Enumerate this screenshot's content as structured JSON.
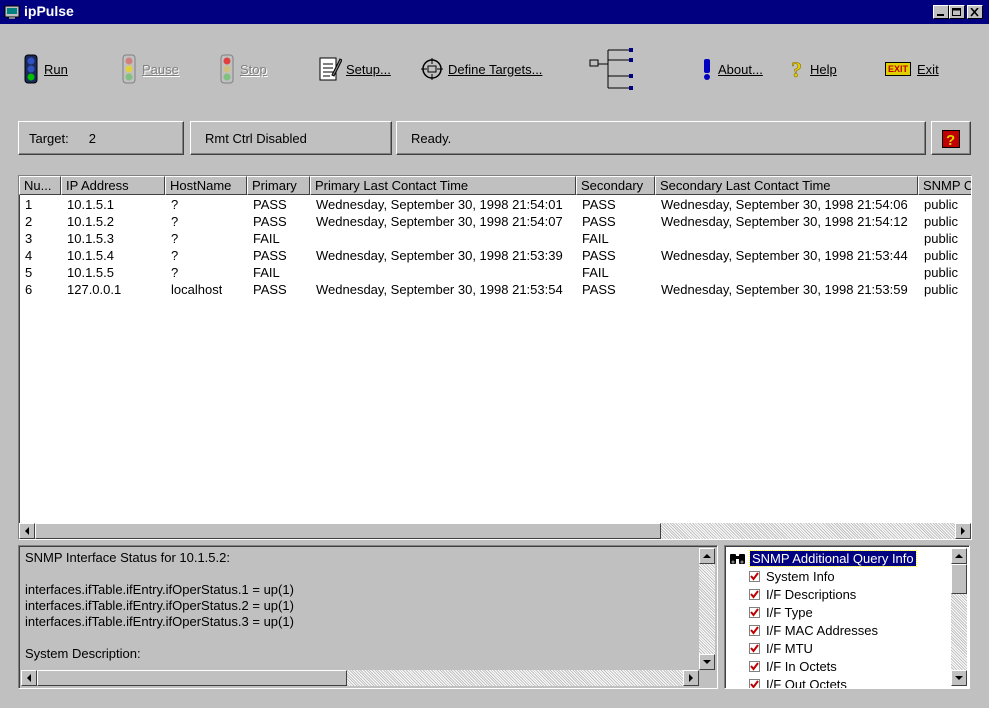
{
  "window": {
    "title": "ipPulse"
  },
  "toolbar": {
    "run": "Run",
    "pause": "Pause",
    "stop": "Stop",
    "setup": "Setup...",
    "define_targets": "Define Targets...",
    "about": "About...",
    "help": "Help",
    "exit": "Exit",
    "exit_badge": "EXIT"
  },
  "status": {
    "target_label": "Target:",
    "target_value": "2",
    "remote": "Rmt Ctrl Disabled",
    "state": "Ready."
  },
  "table": {
    "columns": [
      "Nu...",
      "IP Address",
      "HostName",
      "Primary",
      "Primary Last Contact Time",
      "Secondary",
      "Secondary Last Contact Time",
      "SNMP C"
    ],
    "rows": [
      [
        "1",
        "10.1.5.1",
        "?",
        "PASS",
        "Wednesday, September 30, 1998 21:54:01",
        "PASS",
        "Wednesday, September 30, 1998 21:54:06",
        "public"
      ],
      [
        "2",
        "10.1.5.2",
        "?",
        "PASS",
        "Wednesday, September 30, 1998 21:54:07",
        "PASS",
        "Wednesday, September 30, 1998 21:54:12",
        "public"
      ],
      [
        "3",
        "10.1.5.3",
        "?",
        "FAIL",
        "",
        "FAIL",
        "",
        "public"
      ],
      [
        "4",
        "10.1.5.4",
        "?",
        "PASS",
        "Wednesday, September 30, 1998 21:53:39",
        "PASS",
        "Wednesday, September 30, 1998 21:53:44",
        "public"
      ],
      [
        "5",
        "10.1.5.5",
        "?",
        "FAIL",
        "",
        "FAIL",
        "",
        "public"
      ],
      [
        "6",
        "127.0.0.1",
        "localhost",
        "PASS",
        "Wednesday, September 30, 1998 21:53:54",
        "PASS",
        "Wednesday, September 30, 1998 21:53:59",
        "public"
      ]
    ]
  },
  "detail": {
    "lines": [
      "SNMP Interface Status for 10.1.5.2:",
      "",
      "interfaces.ifTable.ifEntry.ifOperStatus.1 = up(1)",
      "interfaces.ifTable.ifEntry.ifOperStatus.2 = up(1)",
      "interfaces.ifTable.ifEntry.ifOperStatus.3 = up(1)",
      "",
      "System Description:"
    ]
  },
  "tree": {
    "root": "SNMP Additional Query Info",
    "items": [
      "System Info",
      "I/F Descriptions",
      "I/F Type",
      "I/F MAC Addresses",
      "I/F MTU",
      "I/F In Octets",
      "I/F Out Octets"
    ]
  },
  "colors": {
    "titlebar": "#000080",
    "selection": "#000080",
    "face": "#c0c0c0"
  }
}
